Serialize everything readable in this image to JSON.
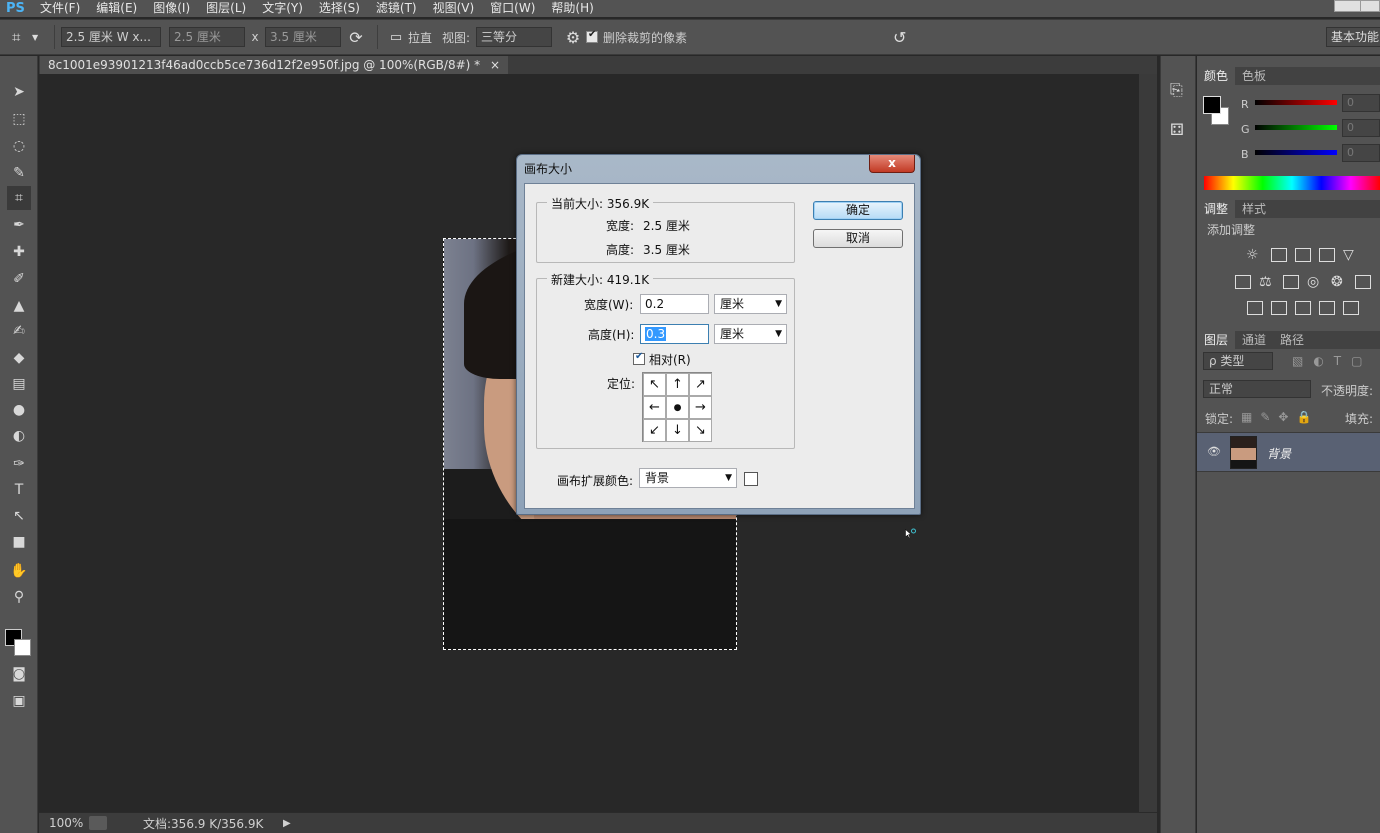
{
  "menubar": {
    "logo": "PS",
    "items": [
      "文件(F)",
      "编辑(E)",
      "图像(I)",
      "图层(L)",
      "文字(Y)",
      "选择(S)",
      "滤镜(T)",
      "视图(V)",
      "窗口(W)",
      "帮助(H)"
    ]
  },
  "options": {
    "preset": "2.5 厘米 W x...",
    "width_field": "2.5 厘米",
    "x_label": "x",
    "height_field": "3.5 厘米",
    "straighten_label": "拉直",
    "view_label": "视图:",
    "view_value": "三等分",
    "delete_cropped_label": "删除裁剪的像素",
    "workspace_label": "基本功能"
  },
  "document": {
    "tab_label": "8c1001e93901213f46ad0ccb5ce736d12f2e950f.jpg @ 100%(RGB/8#) *",
    "tab_close": "×",
    "zoom": "100%",
    "doc_info": "文档:356.9 K/356.9K"
  },
  "panels": {
    "color_tabs": [
      "颜色",
      "色板"
    ],
    "sliders": [
      {
        "label": "R",
        "value": "0",
        "color": "#ff0000"
      },
      {
        "label": "G",
        "value": "0",
        "color": "#00ff00"
      },
      {
        "label": "B",
        "value": "0",
        "color": "#0000ff"
      }
    ],
    "adjust_tabs": [
      "调整",
      "样式"
    ],
    "adjust_title": "添加调整",
    "layer_tabs": [
      "图层",
      "通道",
      "路径"
    ],
    "filter_type": "ρ 类型",
    "blend_mode": "正常",
    "opacity_label": "不透明度:",
    "lock_label": "锁定:",
    "fill_label": "填充:",
    "layer_name": "背景"
  },
  "dialog": {
    "title": "画布大小",
    "close": "x",
    "current_size_label": "当前大小: 356.9K",
    "current_width_label": "宽度:",
    "current_width_value": "2.5 厘米",
    "current_height_label": "高度:",
    "current_height_value": "3.5 厘米",
    "new_size_label": "新建大小: 419.1K",
    "width_label": "宽度(W):",
    "width_value": "0.2",
    "width_unit": "厘米",
    "height_label": "高度(H):",
    "height_value": "0.3",
    "height_unit": "厘米",
    "relative_label": "相对(R)",
    "anchor_label": "定位:",
    "anchor_arrows": [
      "↖",
      "↑",
      "↗",
      "←",
      "●",
      "→",
      "↙",
      "↓",
      "↘"
    ],
    "ext_color_label": "画布扩展颜色:",
    "ext_color_value": "背景",
    "ok_label": "确定",
    "cancel_label": "取消"
  }
}
